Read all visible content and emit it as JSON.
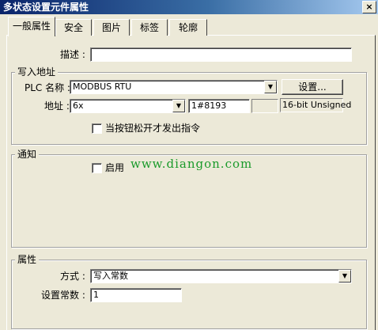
{
  "window": {
    "title": "多状态设置元件属性",
    "close_glyph": "×"
  },
  "tabs": [
    {
      "label": "一般属性"
    },
    {
      "label": "安全"
    },
    {
      "label": "图片"
    },
    {
      "label": "标签"
    },
    {
      "label": "轮廓"
    }
  ],
  "description": {
    "label": "描述 :",
    "value": ""
  },
  "write_address": {
    "legend": "写入地址",
    "plc_label": "PLC 名称 :",
    "plc_value": "MODBUS RTU",
    "settings_button": "设置...",
    "address_label": "地址 :",
    "address_type": "6x",
    "address_value": "1#8193",
    "data_format": "16-bit Unsigned",
    "release_checkbox_label": "当按钮松开才发出指令"
  },
  "notify": {
    "legend": "通知",
    "enable_label": "启用"
  },
  "watermark": "www.diangon.com",
  "attributes": {
    "legend": "属性",
    "mode_label": "方式 :",
    "mode_value": "写入常数",
    "constant_label": "设置常数 :",
    "constant_value": "1"
  },
  "icons": {
    "dropdown": "▼"
  }
}
